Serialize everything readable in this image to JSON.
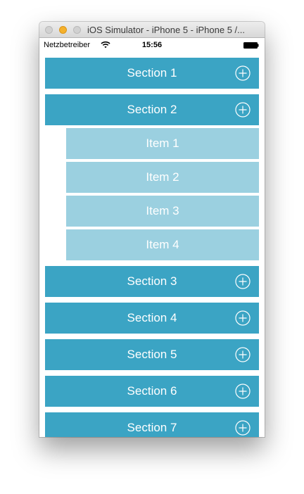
{
  "window": {
    "title": "iOS Simulator - iPhone 5 - iPhone 5 /..."
  },
  "status_bar": {
    "carrier": "Netzbetreiber",
    "time": "15:56",
    "wifi_icon": "wifi-icon",
    "battery_icon": "battery-icon"
  },
  "sections": [
    {
      "label": "Section 1",
      "icon": "plus-circle-icon"
    },
    {
      "label": "Section 2",
      "icon": "plus-circle-icon",
      "items": [
        "Item 1",
        "Item 2",
        "Item 3",
        "Item 4"
      ]
    },
    {
      "label": "Section 3",
      "icon": "plus-circle-icon"
    },
    {
      "label": "Section 4",
      "icon": "plus-circle-icon"
    },
    {
      "label": "Section 5",
      "icon": "plus-circle-icon"
    },
    {
      "label": "Section 6",
      "icon": "plus-circle-icon"
    },
    {
      "label": "Section 7",
      "icon": "plus-circle-icon"
    }
  ],
  "colors": {
    "section_background": "#3ba4c4",
    "item_background": "#9bd0e0",
    "text": "#ffffff"
  }
}
